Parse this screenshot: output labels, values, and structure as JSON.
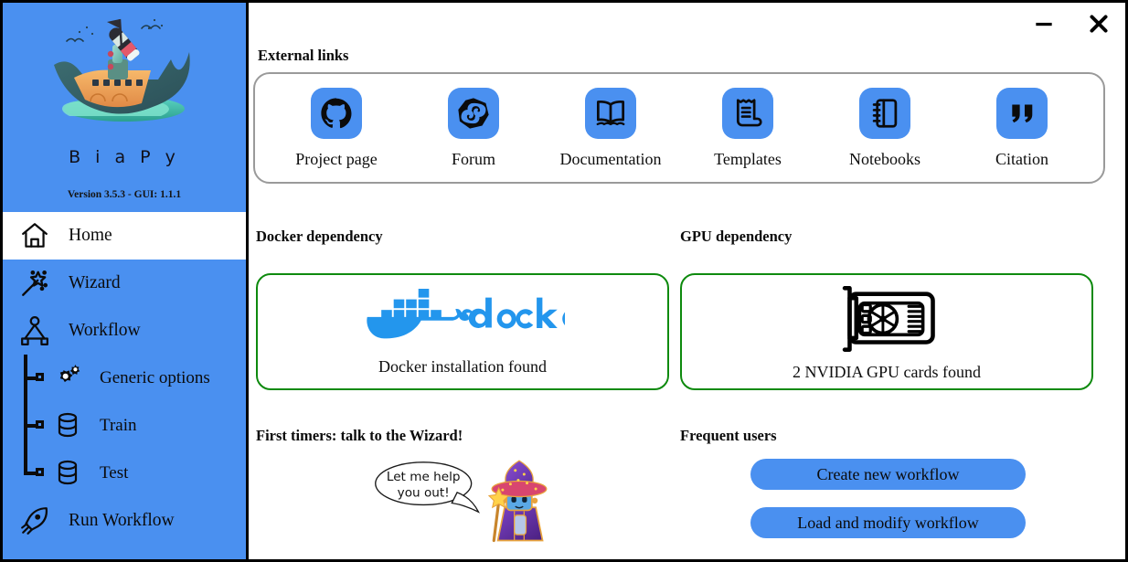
{
  "window": {
    "minimize_label": "−",
    "close_label": "✕"
  },
  "brand": {
    "logo_icon": "biapy-boat-microscope-logo",
    "name": "B i a P y",
    "version": "Version 3.5.3 - GUI: 1.1.1",
    "background_color": "#4a90f0"
  },
  "sidebar": {
    "items": [
      {
        "label": "Home",
        "icon": "home-icon",
        "selected": true
      },
      {
        "label": "Wizard",
        "icon": "magic-wand-icon",
        "selected": false
      },
      {
        "label": "Workflow",
        "icon": "workflow-nodes-icon",
        "selected": false
      },
      {
        "label": "Generic options",
        "icon": "gears-icon",
        "selected": false,
        "sub": true
      },
      {
        "label": "Train",
        "icon": "database-icon",
        "selected": false,
        "sub": true
      },
      {
        "label": "Test",
        "icon": "database-icon",
        "selected": false,
        "sub": true,
        "last": true
      },
      {
        "label": "Run Workflow",
        "icon": "rocket-icon",
        "selected": false
      }
    ]
  },
  "main": {
    "external_links": {
      "title": "External links",
      "items": [
        {
          "label": "Project page",
          "icon": "github-icon"
        },
        {
          "label": "Forum",
          "icon": "image-sc-forum-icon"
        },
        {
          "label": "Documentation",
          "icon": "open-book-icon"
        },
        {
          "label": "Templates",
          "icon": "document-list-icon"
        },
        {
          "label": "Notebooks",
          "icon": "notebook-icon"
        },
        {
          "label": "Citation",
          "icon": "quotation-marks-icon"
        }
      ]
    },
    "docker": {
      "title": "Docker dependency",
      "logo_icon": "docker-whale-logo",
      "status": "Docker installation found",
      "status_color": "#0e8a0e"
    },
    "gpu": {
      "title": "GPU dependency",
      "logo_icon": "gpu-card-icon",
      "status": "2 NVIDIA GPU cards found",
      "status_color": "#0e8a0e"
    },
    "wizard_promo": {
      "title": "First timers: talk to the Wizard!",
      "speech_line1": "Let me help",
      "speech_line2": "you out!",
      "art_icon": "wizard-robot-icon"
    },
    "frequent_users": {
      "title": "Frequent users",
      "buttons": [
        {
          "label": "Create new workflow"
        },
        {
          "label": "Load and modify workflow"
        }
      ],
      "button_color": "#4a90f0"
    }
  }
}
